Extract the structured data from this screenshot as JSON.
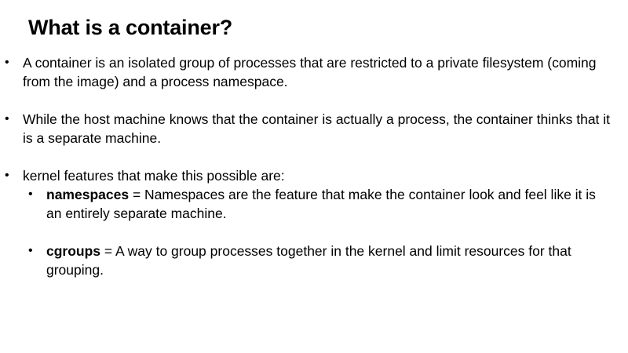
{
  "slide": {
    "title": "What is a container?",
    "bullets": [
      {
        "text": "A container is an isolated group of processes that are restricted to a private filesystem (coming from the image) and a process namespace."
      },
      {
        "text": "While the host machine knows that the container is actually a process, the container thinks that it is a separate machine."
      },
      {
        "text": "kernel features that make this possible are:"
      }
    ],
    "sub_bullets": [
      {
        "term": "namespaces",
        "definition": " = Namespaces are the feature that make the container look and feel like it is an entirely separate machine."
      },
      {
        "term": "cgroups",
        "definition": " = A way to group processes together in the kernel and limit resources for that grouping."
      }
    ],
    "bullet_glyph": "•"
  }
}
